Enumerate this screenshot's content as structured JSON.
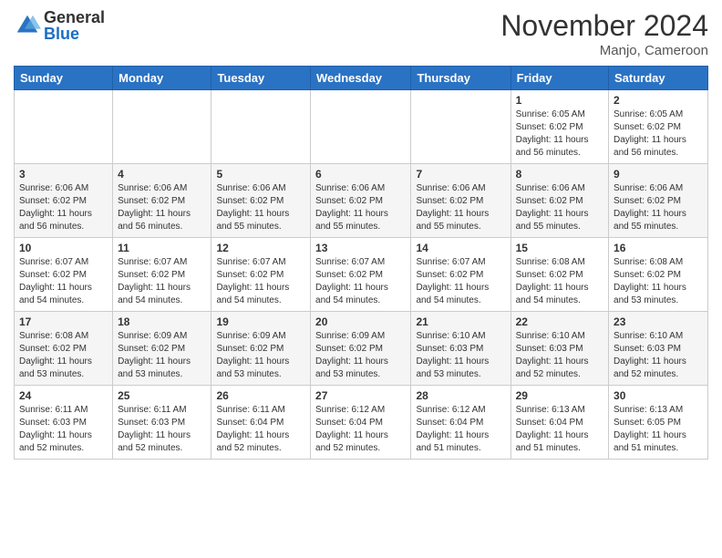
{
  "logo": {
    "general": "General",
    "blue": "Blue"
  },
  "header": {
    "month": "November 2024",
    "location": "Manjo, Cameroon"
  },
  "weekdays": [
    "Sunday",
    "Monday",
    "Tuesday",
    "Wednesday",
    "Thursday",
    "Friday",
    "Saturday"
  ],
  "weeks": [
    [
      {
        "day": "",
        "info": ""
      },
      {
        "day": "",
        "info": ""
      },
      {
        "day": "",
        "info": ""
      },
      {
        "day": "",
        "info": ""
      },
      {
        "day": "",
        "info": ""
      },
      {
        "day": "1",
        "info": "Sunrise: 6:05 AM\nSunset: 6:02 PM\nDaylight: 11 hours\nand 56 minutes."
      },
      {
        "day": "2",
        "info": "Sunrise: 6:05 AM\nSunset: 6:02 PM\nDaylight: 11 hours\nand 56 minutes."
      }
    ],
    [
      {
        "day": "3",
        "info": "Sunrise: 6:06 AM\nSunset: 6:02 PM\nDaylight: 11 hours\nand 56 minutes."
      },
      {
        "day": "4",
        "info": "Sunrise: 6:06 AM\nSunset: 6:02 PM\nDaylight: 11 hours\nand 56 minutes."
      },
      {
        "day": "5",
        "info": "Sunrise: 6:06 AM\nSunset: 6:02 PM\nDaylight: 11 hours\nand 55 minutes."
      },
      {
        "day": "6",
        "info": "Sunrise: 6:06 AM\nSunset: 6:02 PM\nDaylight: 11 hours\nand 55 minutes."
      },
      {
        "day": "7",
        "info": "Sunrise: 6:06 AM\nSunset: 6:02 PM\nDaylight: 11 hours\nand 55 minutes."
      },
      {
        "day": "8",
        "info": "Sunrise: 6:06 AM\nSunset: 6:02 PM\nDaylight: 11 hours\nand 55 minutes."
      },
      {
        "day": "9",
        "info": "Sunrise: 6:06 AM\nSunset: 6:02 PM\nDaylight: 11 hours\nand 55 minutes."
      }
    ],
    [
      {
        "day": "10",
        "info": "Sunrise: 6:07 AM\nSunset: 6:02 PM\nDaylight: 11 hours\nand 54 minutes."
      },
      {
        "day": "11",
        "info": "Sunrise: 6:07 AM\nSunset: 6:02 PM\nDaylight: 11 hours\nand 54 minutes."
      },
      {
        "day": "12",
        "info": "Sunrise: 6:07 AM\nSunset: 6:02 PM\nDaylight: 11 hours\nand 54 minutes."
      },
      {
        "day": "13",
        "info": "Sunrise: 6:07 AM\nSunset: 6:02 PM\nDaylight: 11 hours\nand 54 minutes."
      },
      {
        "day": "14",
        "info": "Sunrise: 6:07 AM\nSunset: 6:02 PM\nDaylight: 11 hours\nand 54 minutes."
      },
      {
        "day": "15",
        "info": "Sunrise: 6:08 AM\nSunset: 6:02 PM\nDaylight: 11 hours\nand 54 minutes."
      },
      {
        "day": "16",
        "info": "Sunrise: 6:08 AM\nSunset: 6:02 PM\nDaylight: 11 hours\nand 53 minutes."
      }
    ],
    [
      {
        "day": "17",
        "info": "Sunrise: 6:08 AM\nSunset: 6:02 PM\nDaylight: 11 hours\nand 53 minutes."
      },
      {
        "day": "18",
        "info": "Sunrise: 6:09 AM\nSunset: 6:02 PM\nDaylight: 11 hours\nand 53 minutes."
      },
      {
        "day": "19",
        "info": "Sunrise: 6:09 AM\nSunset: 6:02 PM\nDaylight: 11 hours\nand 53 minutes."
      },
      {
        "day": "20",
        "info": "Sunrise: 6:09 AM\nSunset: 6:02 PM\nDaylight: 11 hours\nand 53 minutes."
      },
      {
        "day": "21",
        "info": "Sunrise: 6:10 AM\nSunset: 6:03 PM\nDaylight: 11 hours\nand 53 minutes."
      },
      {
        "day": "22",
        "info": "Sunrise: 6:10 AM\nSunset: 6:03 PM\nDaylight: 11 hours\nand 52 minutes."
      },
      {
        "day": "23",
        "info": "Sunrise: 6:10 AM\nSunset: 6:03 PM\nDaylight: 11 hours\nand 52 minutes."
      }
    ],
    [
      {
        "day": "24",
        "info": "Sunrise: 6:11 AM\nSunset: 6:03 PM\nDaylight: 11 hours\nand 52 minutes."
      },
      {
        "day": "25",
        "info": "Sunrise: 6:11 AM\nSunset: 6:03 PM\nDaylight: 11 hours\nand 52 minutes."
      },
      {
        "day": "26",
        "info": "Sunrise: 6:11 AM\nSunset: 6:04 PM\nDaylight: 11 hours\nand 52 minutes."
      },
      {
        "day": "27",
        "info": "Sunrise: 6:12 AM\nSunset: 6:04 PM\nDaylight: 11 hours\nand 52 minutes."
      },
      {
        "day": "28",
        "info": "Sunrise: 6:12 AM\nSunset: 6:04 PM\nDaylight: 11 hours\nand 51 minutes."
      },
      {
        "day": "29",
        "info": "Sunrise: 6:13 AM\nSunset: 6:04 PM\nDaylight: 11 hours\nand 51 minutes."
      },
      {
        "day": "30",
        "info": "Sunrise: 6:13 AM\nSunset: 6:05 PM\nDaylight: 11 hours\nand 51 minutes."
      }
    ]
  ]
}
